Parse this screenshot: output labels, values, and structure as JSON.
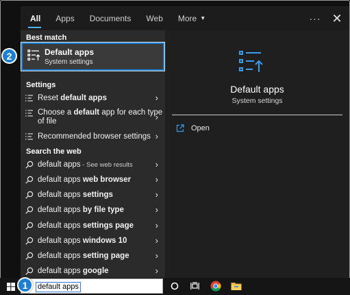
{
  "tabs": [
    {
      "label": "All"
    },
    {
      "label": "Apps"
    },
    {
      "label": "Documents"
    },
    {
      "label": "Web"
    },
    {
      "label": "More"
    }
  ],
  "topbar": {
    "dots": "···",
    "close": "✕"
  },
  "best_match": {
    "header": "Best match",
    "title": "Default apps",
    "subtitle": "System settings"
  },
  "settings": {
    "header": "Settings",
    "items": [
      {
        "pre": "Reset ",
        "bold": "default apps",
        "post": "",
        "line2": ""
      },
      {
        "pre": "Choose a ",
        "bold": "default",
        "post": " app for each type",
        "line2": "of file"
      },
      {
        "pre": "Recommended browser settings",
        "bold": "",
        "post": "",
        "line2": ""
      }
    ]
  },
  "web": {
    "header": "Search the web",
    "items": [
      {
        "pre": "default apps",
        "bold": "",
        "small": " - See web results"
      },
      {
        "pre": "default apps ",
        "bold": "web browser",
        "small": ""
      },
      {
        "pre": "default apps ",
        "bold": "settings",
        "small": ""
      },
      {
        "pre": "default apps ",
        "bold": "by file type",
        "small": ""
      },
      {
        "pre": "default apps ",
        "bold": "settings page",
        "small": ""
      },
      {
        "pre": "default apps ",
        "bold": "windows 10",
        "small": ""
      },
      {
        "pre": "default apps ",
        "bold": "setting page",
        "small": ""
      },
      {
        "pre": "default apps ",
        "bold": "google",
        "small": ""
      }
    ]
  },
  "preview": {
    "title": "Default apps",
    "subtitle": "System settings",
    "open_label": "Open"
  },
  "taskbar": {
    "search_value": "default apps"
  },
  "badges": {
    "step1": "1",
    "step2": "2"
  },
  "colors": {
    "accent": "#1e7fd2",
    "tab_underline": "#4fb2f7",
    "icon_blue": "#3b9cf0"
  }
}
